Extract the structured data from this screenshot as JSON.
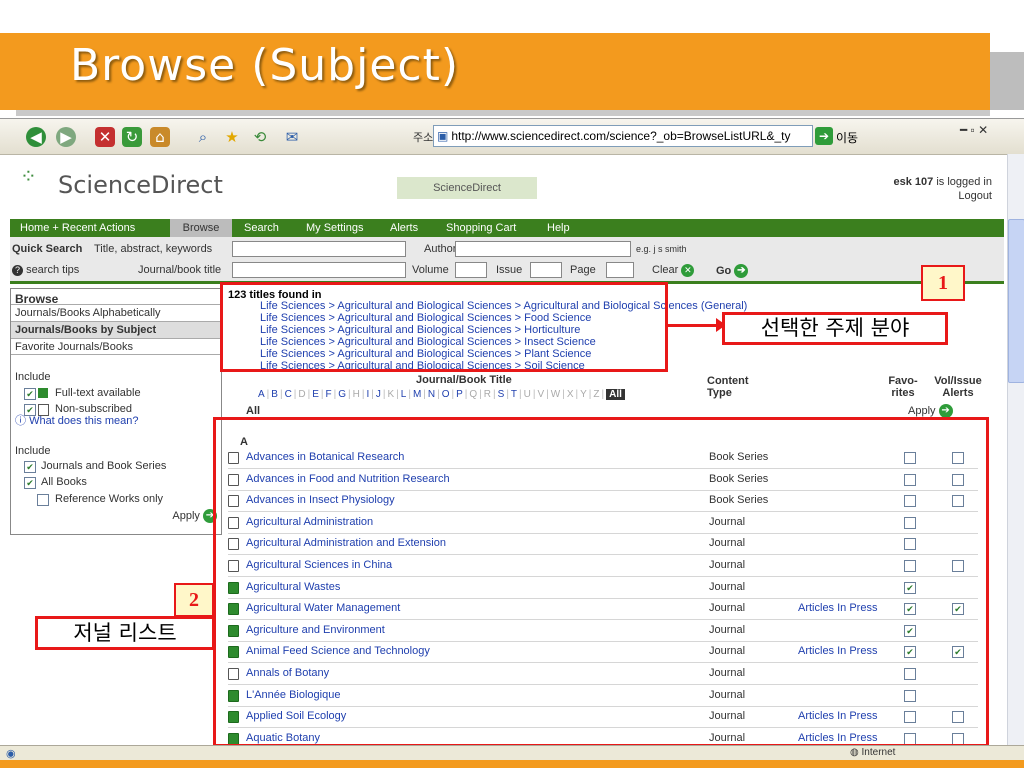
{
  "slide": {
    "title": "Browse (Subject)"
  },
  "browser": {
    "address_label": "주소(D)",
    "address_url": "http://www.sciencedirect.com/science?_ob=BrowseListURL&_ty",
    "go_label": "이동",
    "status_zone": "Internet"
  },
  "header": {
    "logo_text": "ScienceDirect",
    "mini_logo_text": "ScienceDirect",
    "user_name": "esk 107",
    "logged_in_text": "is logged in",
    "logout_link": "Logout"
  },
  "nav": {
    "items": [
      "Home + Recent Actions",
      "Browse",
      "Search",
      "My Settings",
      "Alerts",
      "Shopping Cart",
      "Help"
    ]
  },
  "quick_search": {
    "label": "Quick Search",
    "title_label": "Title, abstract, keywords",
    "author_label": "Author",
    "author_example": "e.g. j s smith",
    "search_tips": "search tips",
    "journal_label": "Journal/book title",
    "volume_label": "Volume",
    "issue_label": "Issue",
    "page_label": "Page",
    "clear_label": "Clear",
    "go_label": "Go"
  },
  "sidebar": {
    "browse_heading": "Browse",
    "items": [
      "Journals/Books Alphabetically",
      "Journals/Books by Subject",
      "Favorite Journals/Books"
    ],
    "include1_heading": "Include",
    "fulltext": "Full-text available",
    "nonsub": "Non-subscribed",
    "what_mean": "What does this mean?",
    "include2_heading": "Include",
    "journals_series": "Journals and Book Series",
    "all_books": "All Books",
    "ref_works": "Reference Works only",
    "apply": "Apply"
  },
  "content": {
    "titles_found": "123 titles found in",
    "crumbs": [
      "Life Sciences > Agricultural and Biological Sciences > Agricultural and Biological Sciences (General)",
      "Life Sciences > Agricultural and Biological Sciences > Food Science",
      "Life Sciences > Agricultural and Biological Sciences > Horticulture",
      "Life Sciences > Agricultural and Biological Sciences > Insect Science",
      "Life Sciences > Agricultural and Biological Sciences > Plant Science",
      "Life Sciences > Agricultural and Biological Sciences > Soil Science"
    ],
    "col_title": "Journal/Book Title",
    "col_content_type": "Content Type",
    "col_favorites": "Favo-rites",
    "col_alerts": "Vol/Issue Alerts",
    "all_label": "All",
    "apply_label": "Apply",
    "letters": [
      "A",
      "B",
      "C",
      "D",
      "E",
      "F",
      "G",
      "H",
      "I",
      "J",
      "K",
      "L",
      "M",
      "N",
      "O",
      "P",
      "Q",
      "R",
      "S",
      "T",
      "U",
      "V",
      "W",
      "X",
      "Y",
      "Z",
      "All"
    ],
    "group_letter": "A",
    "rows": [
      {
        "title": "Advances in Botanical Research",
        "type": "Book Series",
        "aip": "",
        "green": false,
        "fav": false,
        "alert": false,
        "has_alert": true
      },
      {
        "title": "Advances in Food and Nutrition Research",
        "type": "Book Series",
        "aip": "",
        "green": false,
        "fav": false,
        "alert": false,
        "has_alert": true
      },
      {
        "title": "Advances in Insect Physiology",
        "type": "Book Series",
        "aip": "",
        "green": false,
        "fav": false,
        "alert": false,
        "has_alert": true
      },
      {
        "title": "Agricultural Administration",
        "type": "Journal",
        "aip": "",
        "green": false,
        "fav": false,
        "alert": false,
        "has_alert": false
      },
      {
        "title": "Agricultural Administration and Extension",
        "type": "Journal",
        "aip": "",
        "green": false,
        "fav": false,
        "alert": false,
        "has_alert": false
      },
      {
        "title": "Agricultural Sciences in China",
        "type": "Journal",
        "aip": "",
        "green": false,
        "fav": false,
        "alert": false,
        "has_alert": true
      },
      {
        "title": "Agricultural Wastes",
        "type": "Journal",
        "aip": "",
        "green": true,
        "fav": true,
        "alert": false,
        "has_alert": false
      },
      {
        "title": "Agricultural Water Management",
        "type": "Journal",
        "aip": "Articles In Press",
        "green": true,
        "fav": true,
        "alert": true,
        "has_alert": true
      },
      {
        "title": "Agriculture and Environment",
        "type": "Journal",
        "aip": "",
        "green": true,
        "fav": true,
        "alert": false,
        "has_alert": false
      },
      {
        "title": "Animal Feed Science and Technology",
        "type": "Journal",
        "aip": "Articles In Press",
        "green": true,
        "fav": true,
        "alert": true,
        "has_alert": true
      },
      {
        "title": "Annals of Botany",
        "type": "Journal",
        "aip": "",
        "green": false,
        "fav": false,
        "alert": false,
        "has_alert": false
      },
      {
        "title": "L'Année Biologique",
        "type": "Journal",
        "aip": "",
        "green": true,
        "fav": false,
        "alert": false,
        "has_alert": false
      },
      {
        "title": "Applied Soil Ecology",
        "type": "Journal",
        "aip": "Articles In Press",
        "green": true,
        "fav": false,
        "alert": false,
        "has_alert": true
      },
      {
        "title": "Aquatic Botany",
        "type": "Journal",
        "aip": "Articles In Press",
        "green": true,
        "fav": false,
        "alert": false,
        "has_alert": true
      }
    ]
  },
  "annotations": {
    "num1": "1",
    "label1": "선택한 주제 분야",
    "num2": "2",
    "label2": "저널 리스트"
  },
  "colors": {
    "banner": "#f39a1e",
    "nav": "#3b7f1e",
    "annotation": "#e81818",
    "link": "#1f3fae"
  }
}
